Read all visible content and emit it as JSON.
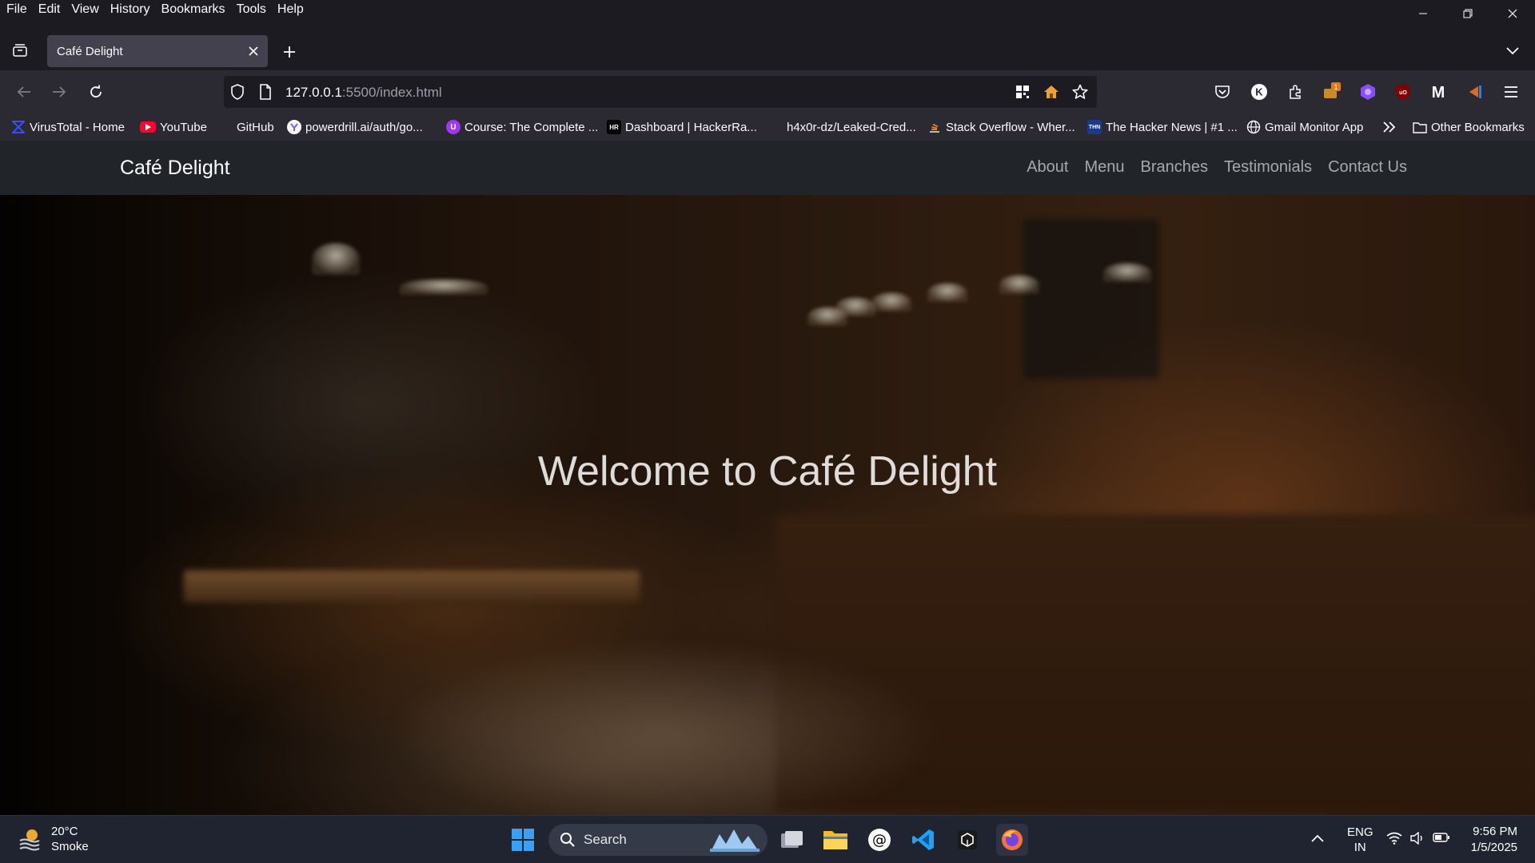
{
  "menubar": {
    "items": [
      "File",
      "Edit",
      "View",
      "History",
      "Bookmarks",
      "Tools",
      "Help"
    ]
  },
  "tab": {
    "title": "Café Delight"
  },
  "url": {
    "host": "127.0.0.1",
    "path": ":5500/index.html"
  },
  "extensions": {
    "badge_count": "1",
    "k_label": "K",
    "m_label": "M"
  },
  "bookmarks": [
    {
      "label": "VirusTotal - Home",
      "icon": "virustotal-icon",
      "color": "#394eff"
    },
    {
      "label": "YouTube",
      "icon": "youtube-icon",
      "color": "#ff0033"
    },
    {
      "label": "GitHub",
      "icon": "github-icon",
      "color": "#2b2a33"
    },
    {
      "label": "powerdrill.ai/auth/go...",
      "icon": "powerdrill-icon",
      "color": "#7b5cff"
    },
    {
      "label": "Course: The Complete ...",
      "icon": "udemy-icon",
      "color": "#a435f0"
    },
    {
      "label": "Dashboard | HackerRa...",
      "icon": "hackerrank-icon",
      "color": "#000000"
    },
    {
      "label": "h4x0r-dz/Leaked-Cred...",
      "icon": "github-icon",
      "color": "#2b2a33"
    },
    {
      "label": "Stack Overflow - Wher...",
      "icon": "stackoverflow-icon",
      "color": "#f48024"
    },
    {
      "label": "The Hacker News | #1 ...",
      "icon": "thn-icon",
      "color": "#1a3a8a"
    },
    {
      "label": "Gmail Monitor App",
      "icon": "globe-icon",
      "color": "#2b2a33"
    }
  ],
  "bookmarks_other": "Other Bookmarks",
  "site": {
    "brand": "Café Delight",
    "nav": [
      "About",
      "Menu",
      "Branches",
      "Testimonials",
      "Contact Us"
    ],
    "hero_title": "Welcome to Café Delight"
  },
  "taskbar": {
    "weather_temp": "20°C",
    "weather_desc": "Smoke",
    "search_label": "Search",
    "lang_top": "ENG",
    "lang_bottom": "IN",
    "time": "9:56 PM",
    "date": "1/5/2025"
  }
}
